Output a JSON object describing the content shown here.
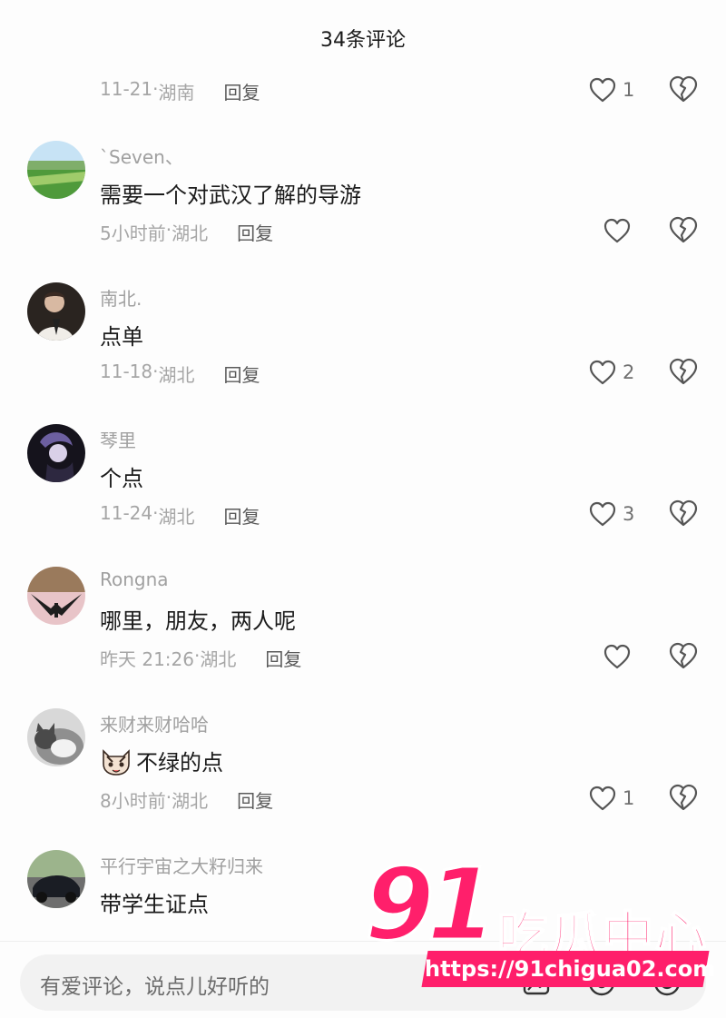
{
  "header": {
    "title": "34条评论"
  },
  "top_partial": {
    "meta_date": "11-21",
    "meta_location": "湖南",
    "reply_label": "回复",
    "like_count": "1"
  },
  "comments": [
    {
      "username": "`Seven、",
      "text": "需要一个对武汉了解的导游",
      "date": "5小时前",
      "location": "湖北",
      "reply_label": "回复",
      "like_count": ""
    },
    {
      "username": "南北.",
      "text": "点单",
      "date": "11-18",
      "location": "湖北",
      "reply_label": "回复",
      "like_count": "2"
    },
    {
      "username": "琴里",
      "text": "个点",
      "date": "11-24",
      "location": "湖北",
      "reply_label": "回复",
      "like_count": "3"
    },
    {
      "username": "Rongna",
      "text": "哪里，朋友，两人呢",
      "date": "昨天 21:26",
      "location": "湖北",
      "reply_label": "回复",
      "like_count": ""
    },
    {
      "username": "来财来财哈哈",
      "text": "不绿的点",
      "date": "8小时前",
      "location": "湖北",
      "reply_label": "回复",
      "like_count": "1",
      "emoji": "cat-emoji"
    },
    {
      "username": "平行宇宙之大籽归来",
      "text": "带学生证点",
      "date": "",
      "location": "",
      "reply_label": "",
      "like_count": ""
    }
  ],
  "bottom_bar": {
    "placeholder": "有爱评论，说点儿好听的",
    "icons": [
      "image-icon",
      "mention-icon",
      "emoji-icon"
    ]
  },
  "watermark": {
    "number": "91",
    "text": "吃瓜中心",
    "url": "https://91chigua02.com"
  },
  "colors": {
    "accent": "#ff1f6b",
    "meta": "#a6a6a6",
    "text": "#1a1a1a",
    "input_bg": "#f2f2f2"
  }
}
